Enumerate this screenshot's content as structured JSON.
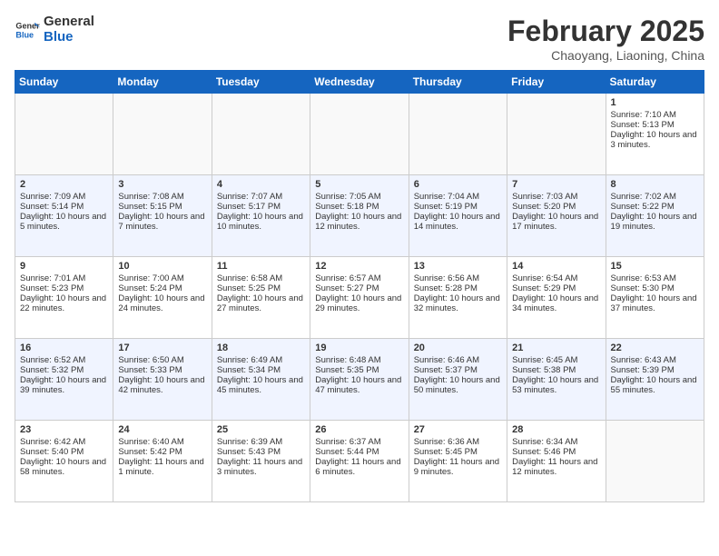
{
  "header": {
    "logo_line1": "General",
    "logo_line2": "Blue",
    "month": "February 2025",
    "location": "Chaoyang, Liaoning, China"
  },
  "weekdays": [
    "Sunday",
    "Monday",
    "Tuesday",
    "Wednesday",
    "Thursday",
    "Friday",
    "Saturday"
  ],
  "weeks": [
    [
      {
        "day": "",
        "info": ""
      },
      {
        "day": "",
        "info": ""
      },
      {
        "day": "",
        "info": ""
      },
      {
        "day": "",
        "info": ""
      },
      {
        "day": "",
        "info": ""
      },
      {
        "day": "",
        "info": ""
      },
      {
        "day": "1",
        "info": "Sunrise: 7:10 AM\nSunset: 5:13 PM\nDaylight: 10 hours and 3 minutes."
      }
    ],
    [
      {
        "day": "2",
        "info": "Sunrise: 7:09 AM\nSunset: 5:14 PM\nDaylight: 10 hours and 5 minutes."
      },
      {
        "day": "3",
        "info": "Sunrise: 7:08 AM\nSunset: 5:15 PM\nDaylight: 10 hours and 7 minutes."
      },
      {
        "day": "4",
        "info": "Sunrise: 7:07 AM\nSunset: 5:17 PM\nDaylight: 10 hours and 10 minutes."
      },
      {
        "day": "5",
        "info": "Sunrise: 7:05 AM\nSunset: 5:18 PM\nDaylight: 10 hours and 12 minutes."
      },
      {
        "day": "6",
        "info": "Sunrise: 7:04 AM\nSunset: 5:19 PM\nDaylight: 10 hours and 14 minutes."
      },
      {
        "day": "7",
        "info": "Sunrise: 7:03 AM\nSunset: 5:20 PM\nDaylight: 10 hours and 17 minutes."
      },
      {
        "day": "8",
        "info": "Sunrise: 7:02 AM\nSunset: 5:22 PM\nDaylight: 10 hours and 19 minutes."
      }
    ],
    [
      {
        "day": "9",
        "info": "Sunrise: 7:01 AM\nSunset: 5:23 PM\nDaylight: 10 hours and 22 minutes."
      },
      {
        "day": "10",
        "info": "Sunrise: 7:00 AM\nSunset: 5:24 PM\nDaylight: 10 hours and 24 minutes."
      },
      {
        "day": "11",
        "info": "Sunrise: 6:58 AM\nSunset: 5:25 PM\nDaylight: 10 hours and 27 minutes."
      },
      {
        "day": "12",
        "info": "Sunrise: 6:57 AM\nSunset: 5:27 PM\nDaylight: 10 hours and 29 minutes."
      },
      {
        "day": "13",
        "info": "Sunrise: 6:56 AM\nSunset: 5:28 PM\nDaylight: 10 hours and 32 minutes."
      },
      {
        "day": "14",
        "info": "Sunrise: 6:54 AM\nSunset: 5:29 PM\nDaylight: 10 hours and 34 minutes."
      },
      {
        "day": "15",
        "info": "Sunrise: 6:53 AM\nSunset: 5:30 PM\nDaylight: 10 hours and 37 minutes."
      }
    ],
    [
      {
        "day": "16",
        "info": "Sunrise: 6:52 AM\nSunset: 5:32 PM\nDaylight: 10 hours and 39 minutes."
      },
      {
        "day": "17",
        "info": "Sunrise: 6:50 AM\nSunset: 5:33 PM\nDaylight: 10 hours and 42 minutes."
      },
      {
        "day": "18",
        "info": "Sunrise: 6:49 AM\nSunset: 5:34 PM\nDaylight: 10 hours and 45 minutes."
      },
      {
        "day": "19",
        "info": "Sunrise: 6:48 AM\nSunset: 5:35 PM\nDaylight: 10 hours and 47 minutes."
      },
      {
        "day": "20",
        "info": "Sunrise: 6:46 AM\nSunset: 5:37 PM\nDaylight: 10 hours and 50 minutes."
      },
      {
        "day": "21",
        "info": "Sunrise: 6:45 AM\nSunset: 5:38 PM\nDaylight: 10 hours and 53 minutes."
      },
      {
        "day": "22",
        "info": "Sunrise: 6:43 AM\nSunset: 5:39 PM\nDaylight: 10 hours and 55 minutes."
      }
    ],
    [
      {
        "day": "23",
        "info": "Sunrise: 6:42 AM\nSunset: 5:40 PM\nDaylight: 10 hours and 58 minutes."
      },
      {
        "day": "24",
        "info": "Sunrise: 6:40 AM\nSunset: 5:42 PM\nDaylight: 11 hours and 1 minute."
      },
      {
        "day": "25",
        "info": "Sunrise: 6:39 AM\nSunset: 5:43 PM\nDaylight: 11 hours and 3 minutes."
      },
      {
        "day": "26",
        "info": "Sunrise: 6:37 AM\nSunset: 5:44 PM\nDaylight: 11 hours and 6 minutes."
      },
      {
        "day": "27",
        "info": "Sunrise: 6:36 AM\nSunset: 5:45 PM\nDaylight: 11 hours and 9 minutes."
      },
      {
        "day": "28",
        "info": "Sunrise: 6:34 AM\nSunset: 5:46 PM\nDaylight: 11 hours and 12 minutes."
      },
      {
        "day": "",
        "info": ""
      }
    ]
  ]
}
